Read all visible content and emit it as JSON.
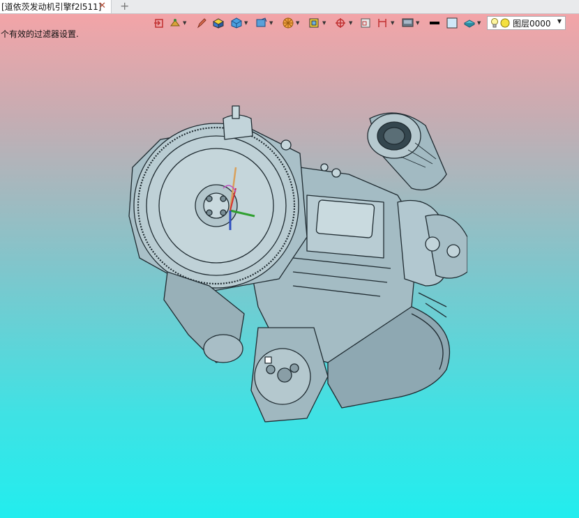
{
  "tab": {
    "title": "[道依茨发动机引擎f2l511]",
    "close_glyph": "✕",
    "new_tab_glyph": "+"
  },
  "toolbar": {
    "icons": [
      "exit-view-icon",
      "layer-tree-icon",
      "pencil-icon",
      "solid-yellow-icon",
      "cube-blue-icon",
      "view-orient-icon",
      "render-mode-icon",
      "section-icon",
      "origin-axis-icon",
      "window-frame-icon",
      "dimension-icon",
      "display-icon",
      "line-color-black-icon",
      "fill-color-icon",
      "material-icon"
    ],
    "layer": {
      "label": "图层0000"
    }
  },
  "status": {
    "message": "个有效的过滤器设置."
  },
  "colors": {
    "engine_fill": "#9ab4bd",
    "engine_stroke": "#1e2a30",
    "axis_x": "#d33030",
    "axis_y": "#30a030",
    "axis_z": "#3050c0"
  }
}
